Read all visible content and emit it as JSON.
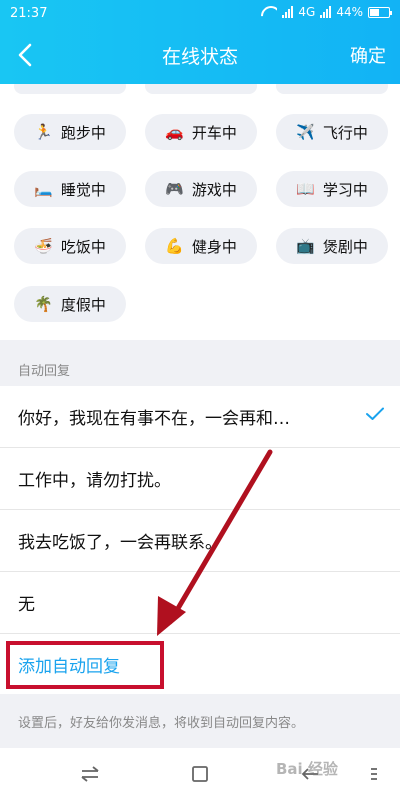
{
  "status_bar": {
    "time": "21:37",
    "network": "4G",
    "battery": "44%"
  },
  "header": {
    "title": "在线状态",
    "confirm_label": "确定"
  },
  "statuses": [
    {
      "label": "跑步中",
      "emoji": "🏃"
    },
    {
      "label": "开车中",
      "emoji": "🚗"
    },
    {
      "label": "飞行中",
      "emoji": "✈️"
    },
    {
      "label": "睡觉中",
      "emoji": "🛏️"
    },
    {
      "label": "游戏中",
      "emoji": "🎮"
    },
    {
      "label": "学习中",
      "emoji": "📖"
    },
    {
      "label": "吃饭中",
      "emoji": "🍜"
    },
    {
      "label": "健身中",
      "emoji": "💪"
    },
    {
      "label": "煲剧中",
      "emoji": "📺"
    },
    {
      "label": "度假中",
      "emoji": "🌴"
    }
  ],
  "auto_reply": {
    "section_label": "自动回复",
    "items": [
      {
        "text": "你好，我现在有事不在，一会再和…",
        "selected": true
      },
      {
        "text": "工作中，请勿打扰。",
        "selected": false
      },
      {
        "text": "我去吃饭了，一会再联系。",
        "selected": false
      },
      {
        "text": "无",
        "selected": false
      }
    ],
    "add_label": "添加自动回复",
    "hint": "设置后，好友给你发消息，将收到自动回复内容。"
  },
  "watermark": "Bai 经验",
  "colors": {
    "header": "#15bdf4",
    "accent": "#1aa3ee",
    "annotation": "#c8102e"
  }
}
